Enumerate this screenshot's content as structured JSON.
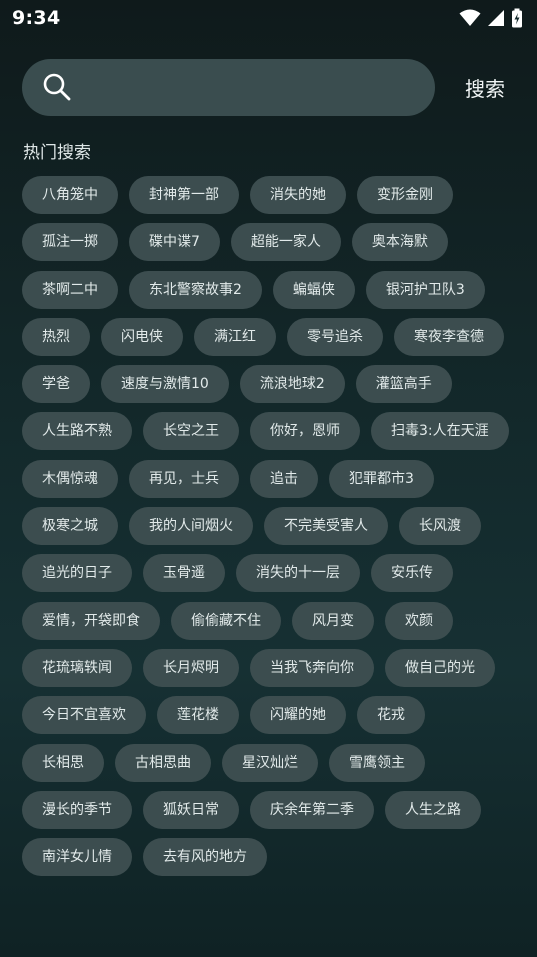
{
  "status_bar": {
    "time": "9:34",
    "icons": [
      "wifi-icon",
      "cellular-signal-icon",
      "battery-charging-icon"
    ]
  },
  "search": {
    "placeholder": "",
    "value": "",
    "button_label": "搜索"
  },
  "hot_search": {
    "title": "热门搜索",
    "rows": [
      [
        "八角笼中",
        "封神第一部",
        "消失的她",
        "变形金刚"
      ],
      [
        "孤注一掷",
        "碟中谍7",
        "超能一家人",
        "奥本海默"
      ],
      [
        "茶啊二中",
        "东北警察故事2",
        "蝙蝠侠",
        "银河护卫队3"
      ],
      [
        "热烈",
        "闪电侠",
        "满江红",
        "零号追杀",
        "寒夜李查德"
      ],
      [
        "学爸",
        "速度与激情10",
        "流浪地球2",
        "灌篮高手"
      ],
      [
        "人生路不熟",
        "长空之王",
        "你好，恩师",
        "扫毒3:人在天涯"
      ],
      [
        "木偶惊魂",
        "再见，士兵",
        "追击",
        "犯罪都市3"
      ],
      [
        "极寒之城",
        "我的人间烟火",
        "不完美受害人",
        "长风渡"
      ],
      [
        "追光的日子",
        "玉骨遥",
        "消失的十一层",
        "安乐传"
      ],
      [
        "爱情，开袋即食",
        "偷偷藏不住",
        "风月变",
        "欢颜"
      ],
      [
        "花琉璃轶闻",
        "长月烬明",
        "当我飞奔向你",
        "做自己的光"
      ],
      [
        "今日不宜喜欢",
        "莲花楼",
        "闪耀的她",
        "花戎"
      ],
      [
        "长相思",
        "古相思曲",
        "星汉灿烂",
        "雪鹰领主"
      ],
      [
        "漫长的季节",
        "狐妖日常",
        "庆余年第二季",
        "人生之路"
      ],
      [
        "南洋女儿情",
        "去有风的地方"
      ]
    ]
  },
  "colors": {
    "background": "#13292b",
    "search_box": "#3a4d4f",
    "tag_background": "#3c4d4f",
    "text": "#e2eaea"
  }
}
